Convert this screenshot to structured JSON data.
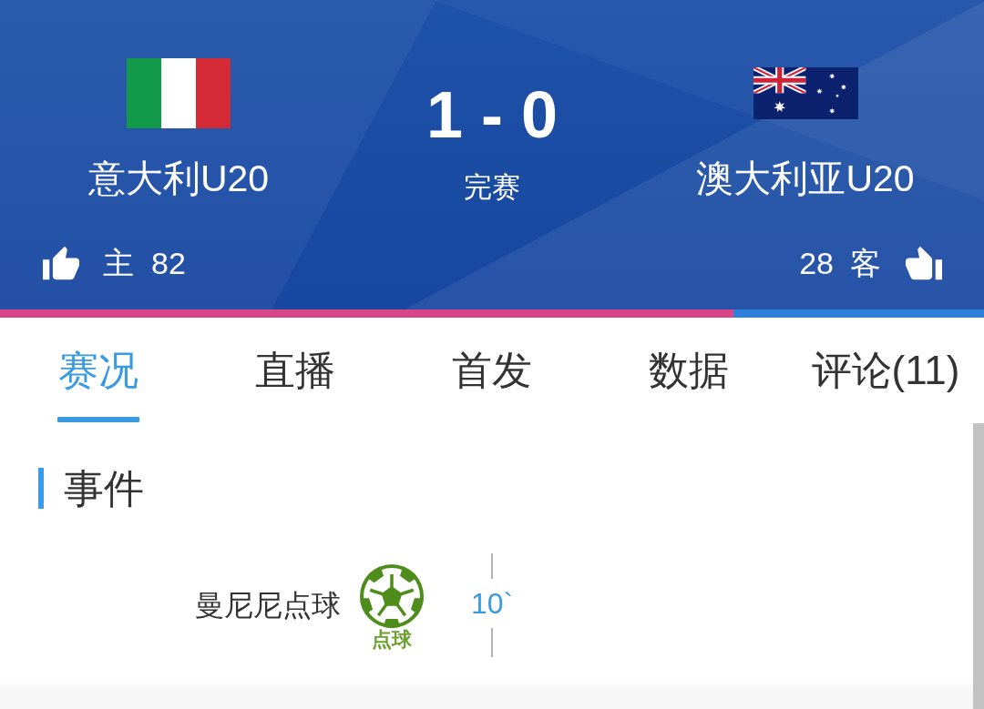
{
  "match": {
    "home": {
      "name": "意大利U20"
    },
    "score": "1 - 0",
    "status": "完赛",
    "away": {
      "name": "澳大利亚U20"
    }
  },
  "support": {
    "home": {
      "label": "主",
      "count": "82"
    },
    "away": {
      "count": "28",
      "label": "客"
    },
    "level": 0.745
  },
  "tabs": [
    {
      "label": "赛况",
      "selected": true
    },
    {
      "label": "直播",
      "selected": false
    },
    {
      "label": "首发",
      "selected": false
    },
    {
      "label": "数据",
      "selected": false
    },
    {
      "label": "评论(11)",
      "selected": false
    }
  ],
  "events": {
    "title": "事件",
    "items": [
      {
        "home": {
          "kind": "penalty",
          "text": "曼尼尼点球",
          "badge": "点球"
        },
        "minute": "10`"
      }
    ]
  }
}
